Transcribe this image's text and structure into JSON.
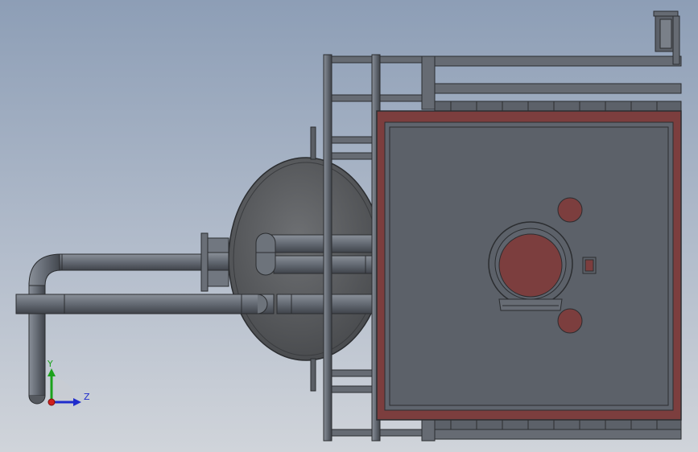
{
  "viewport": {
    "background_top": "#8d9eb6",
    "background_bottom": "#d0d4da"
  },
  "colors": {
    "steel": "#5e646c",
    "steel_light": "#7c838c",
    "steel_dark": "#3a3e45",
    "panel": "#5f646d",
    "accent_red": "#7c3e3e",
    "tank": "#5a5c5e"
  },
  "triad": {
    "y_label": "Y",
    "z_label": "Z",
    "x_color": "#d0201c",
    "y_color": "#1ca21c",
    "z_color": "#1f2ccc",
    "icon": "coordinate-triad-icon"
  }
}
